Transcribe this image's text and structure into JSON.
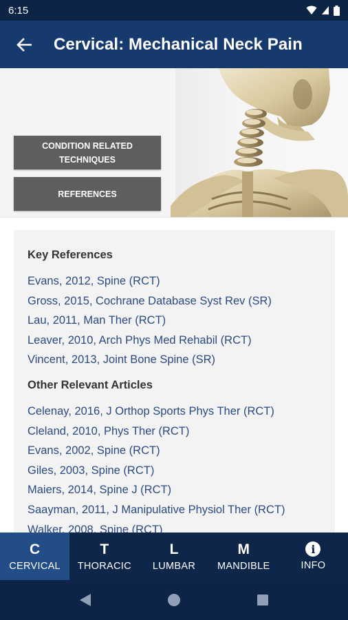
{
  "status": {
    "time": "6:15"
  },
  "header": {
    "title": "Cervical: Mechanical Neck Pain"
  },
  "hero": {
    "button_techniques": "CONDITION RELATED TECHNIQUES",
    "button_references": "REFERENCES"
  },
  "key_references": {
    "title": "Key References",
    "items": [
      "Evans, 2012, Spine (RCT)",
      "Gross, 2015, Cochrane Database Syst Rev (SR)",
      "Lau, 2011, Man Ther (RCT)",
      "Leaver, 2010, Arch Phys Med Rehabil (RCT)",
      "Vincent, 2013, Joint Bone Spine (SR)"
    ]
  },
  "other_articles": {
    "title": "Other Relevant Articles",
    "items": [
      "Celenay, 2016, J Orthop Sports Phys Ther (RCT)",
      "Cleland, 2010, Phys Ther (RCT)",
      "Evans, 2002, Spine (RCT)",
      "Giles, 2003, Spine (RCT)",
      "Maiers, 2014, Spine J (RCT)",
      "Saayman, 2011, J Manipulative Physiol Ther (RCT)",
      "Walker, 2008, Spine (RCT)"
    ]
  },
  "bottom_nav": [
    {
      "letter": "C",
      "label": "CERVICAL",
      "active": true
    },
    {
      "letter": "T",
      "label": "THORACIC",
      "active": false
    },
    {
      "letter": "L",
      "label": "LUMBAR",
      "active": false
    },
    {
      "letter": "M",
      "label": "MANDIBLE",
      "active": false
    },
    {
      "letter": "i",
      "label": "INFO",
      "active": false
    }
  ],
  "colors": {
    "app_bar": "#173a6e",
    "status_bar": "#0d2447",
    "active_tab": "#234d86",
    "link": "#2a4a80",
    "hero_button": "#5e5e5e"
  },
  "icons": {
    "back": "arrow-left-icon",
    "wifi": "wifi-icon",
    "battery": "battery-icon",
    "info": "info-icon"
  }
}
